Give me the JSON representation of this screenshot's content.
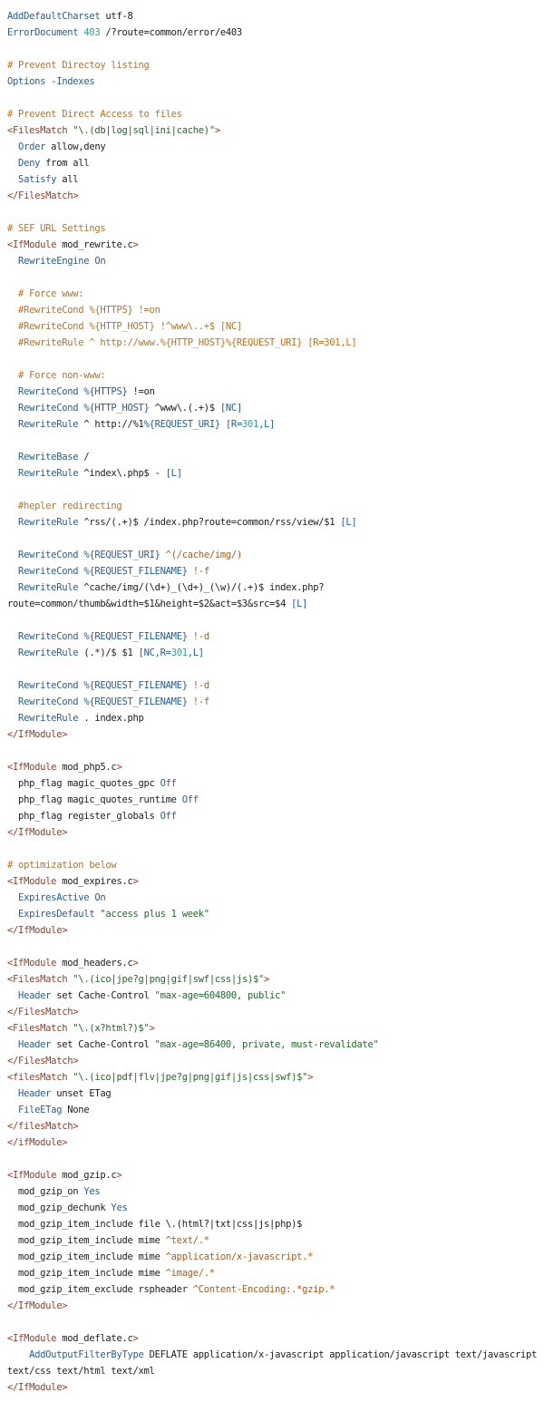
{
  "colors": {
    "background": "#ffffff",
    "text": "#1c1c1c",
    "directive": "#1c5fa6",
    "comment": "#c2701f",
    "section_tag": "#9b3a1f",
    "string": "#1f6b28",
    "number": "#2aa198",
    "operator": "#b05a18"
  },
  "lines": [
    [
      [
        "k",
        "AddDefaultCharset"
      ],
      [
        "d",
        " utf-8"
      ]
    ],
    [
      [
        "k",
        "ErrorDocument"
      ],
      [
        "d",
        " "
      ],
      [
        "n",
        "403"
      ],
      [
        "d",
        " /?route=common/error/e403"
      ]
    ],
    [],
    [
      [
        "c",
        "# Prevent Directoy listing"
      ]
    ],
    [
      [
        "k",
        "Options"
      ],
      [
        "d",
        " "
      ],
      [
        "k",
        "-Indexes"
      ]
    ],
    [],
    [
      [
        "c",
        "# Prevent Direct Access to files"
      ]
    ],
    [
      [
        "g",
        "<FilesMatch"
      ],
      [
        "d",
        " "
      ],
      [
        "s",
        "\"\\.(db|log|sql|ini|cache)\""
      ],
      [
        "g",
        ">"
      ]
    ],
    [
      [
        "d",
        "  "
      ],
      [
        "k",
        "Order"
      ],
      [
        "d",
        " allow,deny"
      ]
    ],
    [
      [
        "d",
        "  "
      ],
      [
        "k",
        "Deny"
      ],
      [
        "d",
        " from all"
      ]
    ],
    [
      [
        "d",
        "  "
      ],
      [
        "k",
        "Satisfy"
      ],
      [
        "d",
        " all"
      ]
    ],
    [
      [
        "g",
        "</FilesMatch>"
      ]
    ],
    [],
    [
      [
        "c",
        "# SEF URL Settings"
      ]
    ],
    [
      [
        "g",
        "<IfModule"
      ],
      [
        "d",
        " mod_rewrite.c"
      ],
      [
        "g",
        ">"
      ]
    ],
    [
      [
        "d",
        "  "
      ],
      [
        "k",
        "RewriteEngine"
      ],
      [
        "d",
        " "
      ],
      [
        "k",
        "On"
      ]
    ],
    [],
    [
      [
        "d",
        "  "
      ],
      [
        "c",
        "# Force www:"
      ]
    ],
    [
      [
        "d",
        "  "
      ],
      [
        "c",
        "#RewriteCond %{HTTPS} !=on"
      ]
    ],
    [
      [
        "d",
        "  "
      ],
      [
        "c",
        "#RewriteCond %{HTTP_HOST} !^www\\..+$ [NC]"
      ]
    ],
    [
      [
        "d",
        "  "
      ],
      [
        "c",
        "#RewriteRule ^ http://www.%{HTTP_HOST}%{REQUEST_URI} [R=301,L]"
      ]
    ],
    [],
    [
      [
        "d",
        "  "
      ],
      [
        "c",
        "# Force non-www:"
      ]
    ],
    [
      [
        "d",
        "  "
      ],
      [
        "k",
        "RewriteCond"
      ],
      [
        "d",
        " "
      ],
      [
        "k",
        "%{HTTPS}"
      ],
      [
        "d",
        " !=on"
      ]
    ],
    [
      [
        "d",
        "  "
      ],
      [
        "k",
        "RewriteCond"
      ],
      [
        "d",
        " "
      ],
      [
        "k",
        "%{HTTP_HOST}"
      ],
      [
        "d",
        " ^www\\.(.+)$ "
      ],
      [
        "k",
        "[NC]"
      ]
    ],
    [
      [
        "d",
        "  "
      ],
      [
        "k",
        "RewriteRule"
      ],
      [
        "d",
        " ^ http://%1"
      ],
      [
        "k",
        "%{REQUEST_URI}"
      ],
      [
        "d",
        " "
      ],
      [
        "k",
        "[R="
      ],
      [
        "n",
        "301"
      ],
      [
        "k",
        ",L]"
      ]
    ],
    [],
    [
      [
        "d",
        "  "
      ],
      [
        "k",
        "RewriteBase"
      ],
      [
        "d",
        " /"
      ]
    ],
    [
      [
        "d",
        "  "
      ],
      [
        "k",
        "RewriteRule"
      ],
      [
        "d",
        " ^index\\.php$ - "
      ],
      [
        "k",
        "[L]"
      ]
    ],
    [],
    [
      [
        "d",
        "  "
      ],
      [
        "c",
        "#hepler redirecting"
      ]
    ],
    [
      [
        "d",
        "  "
      ],
      [
        "k",
        "RewriteRule"
      ],
      [
        "d",
        " ^rss/(.+)$ /index.php?route=common/rss/view/$1 "
      ],
      [
        "k",
        "[L]"
      ]
    ],
    [],
    [
      [
        "d",
        "  "
      ],
      [
        "k",
        "RewriteCond"
      ],
      [
        "d",
        " "
      ],
      [
        "k",
        "%{REQUEST_URI}"
      ],
      [
        "d",
        " "
      ],
      [
        "o",
        "^(/cache/img/)"
      ]
    ],
    [
      [
        "d",
        "  "
      ],
      [
        "k",
        "RewriteCond"
      ],
      [
        "d",
        " "
      ],
      [
        "k",
        "%{REQUEST_FILENAME}"
      ],
      [
        "d",
        " "
      ],
      [
        "o",
        "!-f"
      ]
    ],
    [
      [
        "d",
        "  "
      ],
      [
        "k",
        "RewriteRule"
      ],
      [
        "d",
        " ^cache/img/(\\d+)_(\\d+)_(\\w)/(.+)$ index.php?"
      ]
    ],
    [
      [
        "d",
        "route=common/thumb&width=$1&height=$2&act=$3&src=$4 "
      ],
      [
        "k",
        "[L]"
      ]
    ],
    [],
    [
      [
        "d",
        "  "
      ],
      [
        "k",
        "RewriteCond"
      ],
      [
        "d",
        " "
      ],
      [
        "k",
        "%{REQUEST_FILENAME}"
      ],
      [
        "d",
        " "
      ],
      [
        "o",
        "!-d"
      ]
    ],
    [
      [
        "d",
        "  "
      ],
      [
        "k",
        "RewriteRule"
      ],
      [
        "d",
        " (.*)/$ $1 "
      ],
      [
        "k",
        "[NC,R="
      ],
      [
        "n",
        "301"
      ],
      [
        "k",
        ",L]"
      ]
    ],
    [],
    [
      [
        "d",
        "  "
      ],
      [
        "k",
        "RewriteCond"
      ],
      [
        "d",
        " "
      ],
      [
        "k",
        "%{REQUEST_FILENAME}"
      ],
      [
        "d",
        " "
      ],
      [
        "o",
        "!-d"
      ]
    ],
    [
      [
        "d",
        "  "
      ],
      [
        "k",
        "RewriteCond"
      ],
      [
        "d",
        " "
      ],
      [
        "k",
        "%{REQUEST_FILENAME}"
      ],
      [
        "d",
        " "
      ],
      [
        "o",
        "!-f"
      ]
    ],
    [
      [
        "d",
        "  "
      ],
      [
        "k",
        "RewriteRule"
      ],
      [
        "d",
        " . index.php"
      ]
    ],
    [
      [
        "g",
        "</IfModule>"
      ]
    ],
    [],
    [
      [
        "g",
        "<IfModule"
      ],
      [
        "d",
        " mod_php5.c"
      ],
      [
        "g",
        ">"
      ]
    ],
    [
      [
        "d",
        "  php_flag magic_quotes_gpc "
      ],
      [
        "k",
        "Off"
      ]
    ],
    [
      [
        "d",
        "  php_flag magic_quotes_runtime "
      ],
      [
        "k",
        "Off"
      ]
    ],
    [
      [
        "d",
        "  php_flag register_globals "
      ],
      [
        "k",
        "Off"
      ]
    ],
    [
      [
        "g",
        "</IfModule>"
      ]
    ],
    [],
    [
      [
        "c",
        "# optimization below"
      ]
    ],
    [
      [
        "g",
        "<IfModule"
      ],
      [
        "d",
        " mod_expires.c"
      ],
      [
        "g",
        ">"
      ]
    ],
    [
      [
        "d",
        "  "
      ],
      [
        "k",
        "ExpiresActive"
      ],
      [
        "d",
        " "
      ],
      [
        "k",
        "On"
      ]
    ],
    [
      [
        "d",
        "  "
      ],
      [
        "k",
        "ExpiresDefault"
      ],
      [
        "d",
        " "
      ],
      [
        "s",
        "\"access plus 1 week\""
      ]
    ],
    [
      [
        "g",
        "</IfModule>"
      ]
    ],
    [],
    [
      [
        "g",
        "<IfModule"
      ],
      [
        "d",
        " mod_headers.c"
      ],
      [
        "g",
        ">"
      ]
    ],
    [
      [
        "g",
        "<FilesMatch"
      ],
      [
        "d",
        " "
      ],
      [
        "s",
        "\"\\.(ico|jpe?g|png|gif|swf|css|js)$\""
      ],
      [
        "g",
        ">"
      ]
    ],
    [
      [
        "d",
        "  "
      ],
      [
        "k",
        "Header"
      ],
      [
        "d",
        " set Cache-Control "
      ],
      [
        "s",
        "\"max-age=604800, public\""
      ]
    ],
    [
      [
        "g",
        "</FilesMatch>"
      ]
    ],
    [
      [
        "g",
        "<FilesMatch"
      ],
      [
        "d",
        " "
      ],
      [
        "s",
        "\"\\.(x?html?)$\""
      ],
      [
        "g",
        ">"
      ]
    ],
    [
      [
        "d",
        "  "
      ],
      [
        "k",
        "Header"
      ],
      [
        "d",
        " set Cache-Control "
      ],
      [
        "s",
        "\"max-age=86400, private, must-revalidate\""
      ]
    ],
    [
      [
        "g",
        "</FilesMatch>"
      ]
    ],
    [
      [
        "g",
        "<filesMatch"
      ],
      [
        "d",
        " "
      ],
      [
        "s",
        "\"\\.(ico|pdf|flv|jpe?g|png|gif|js|css|swf)$\""
      ],
      [
        "g",
        ">"
      ]
    ],
    [
      [
        "d",
        "  "
      ],
      [
        "k",
        "Header"
      ],
      [
        "d",
        " unset ETag"
      ]
    ],
    [
      [
        "d",
        "  "
      ],
      [
        "k",
        "FileETag"
      ],
      [
        "d",
        " None"
      ]
    ],
    [
      [
        "g",
        "</filesMatch>"
      ]
    ],
    [
      [
        "g",
        "</ifModule>"
      ]
    ],
    [],
    [
      [
        "g",
        "<IfModule"
      ],
      [
        "d",
        " mod_gzip.c"
      ],
      [
        "g",
        ">"
      ]
    ],
    [
      [
        "d",
        "  mod_gzip_on "
      ],
      [
        "k",
        "Yes"
      ]
    ],
    [
      [
        "d",
        "  mod_gzip_dechunk "
      ],
      [
        "k",
        "Yes"
      ]
    ],
    [
      [
        "d",
        "  mod_gzip_item_include file \\.(html?|txt|css|js|php)$"
      ]
    ],
    [
      [
        "d",
        "  mod_gzip_item_include mime "
      ],
      [
        "o",
        "^text/.*"
      ]
    ],
    [
      [
        "d",
        "  mod_gzip_item_include mime "
      ],
      [
        "o",
        "^application/x-javascript.*"
      ]
    ],
    [
      [
        "d",
        "  mod_gzip_item_include mime "
      ],
      [
        "o",
        "^image/.*"
      ]
    ],
    [
      [
        "d",
        "  mod_gzip_item_exclude rspheader "
      ],
      [
        "o",
        "^Content-Encoding:.*gzip.*"
      ]
    ],
    [
      [
        "g",
        "</IfModule>"
      ]
    ],
    [],
    [
      [
        "g",
        "<IfModule"
      ],
      [
        "d",
        " mod_deflate.c"
      ],
      [
        "g",
        ">"
      ]
    ],
    [
      [
        "d",
        "    "
      ],
      [
        "k",
        "AddOutputFilterByType"
      ],
      [
        "d",
        " DEFLATE application/x-javascript application/javascript text/javascript"
      ]
    ],
    [
      [
        "d",
        "text/css text/html text/xml"
      ]
    ],
    [
      [
        "g",
        "</IfModule>"
      ]
    ]
  ]
}
